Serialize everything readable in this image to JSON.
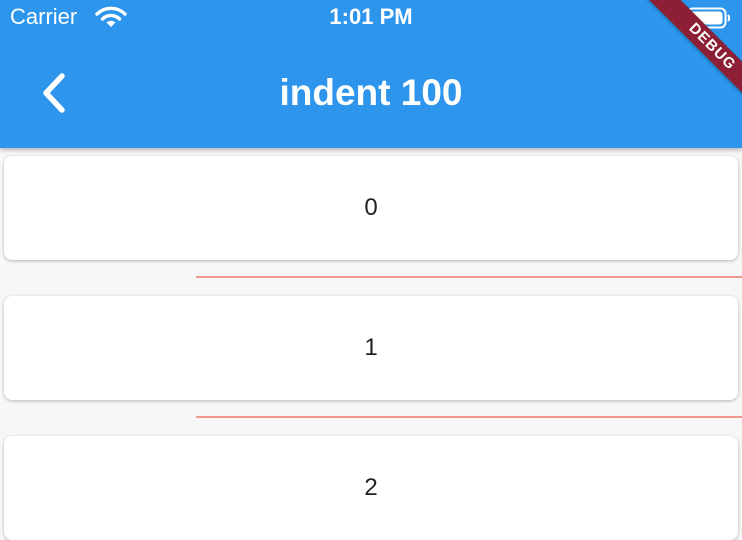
{
  "status_bar": {
    "carrier": "Carrier",
    "time": "1:01 PM"
  },
  "app_bar": {
    "title": "indent 100",
    "back_icon": "chevron-left-icon",
    "color": "#2d96ec"
  },
  "debug_banner": {
    "label": "DEBUG",
    "color": "#8c1f36"
  },
  "list": {
    "items": [
      {
        "label": "0"
      },
      {
        "label": "1"
      },
      {
        "label": "2"
      }
    ],
    "divider_color": "#ef9a8f"
  }
}
